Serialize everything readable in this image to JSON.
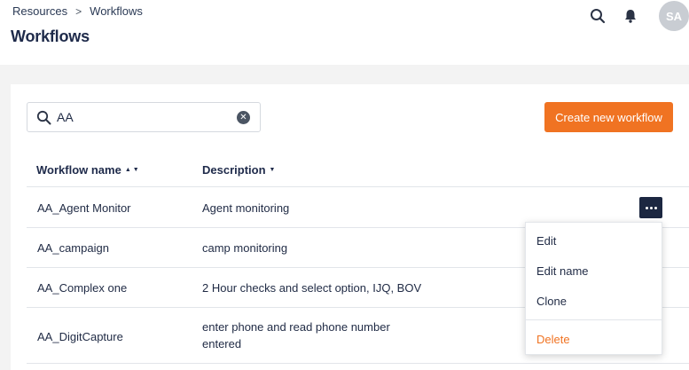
{
  "header": {
    "breadcrumb": [
      "Resources",
      "Workflows"
    ],
    "breadcrumb_separator": ">",
    "title": "Workflows",
    "avatar_initials": "SA",
    "icons": [
      "search-icon",
      "bell-icon"
    ]
  },
  "toolbar": {
    "search_value": "AA",
    "search_placeholder": "",
    "create_button_label": "Create new workflow"
  },
  "table": {
    "columns": [
      {
        "label": "Workflow name",
        "sort": "▲ ▼"
      },
      {
        "label": "Description",
        "sort": "▼"
      }
    ],
    "rows": [
      {
        "name": "AA_Agent Monitor",
        "description": "Agent monitoring"
      },
      {
        "name": "AA_campaign",
        "description": "camp monitoring"
      },
      {
        "name": "AA_Complex one",
        "description": "2 Hour checks and select option, IJQ, BOV"
      },
      {
        "name": "AA_DigitCapture",
        "description": "enter phone and read phone number entered"
      }
    ]
  },
  "row_menu": {
    "items": [
      "Edit",
      "Edit name",
      "Clone"
    ],
    "danger_item": "Delete"
  },
  "colors": {
    "accent": "#f07322",
    "primary_dark": "#1c2741",
    "title": "#1e2a4a",
    "background": "#f3f3f3"
  }
}
